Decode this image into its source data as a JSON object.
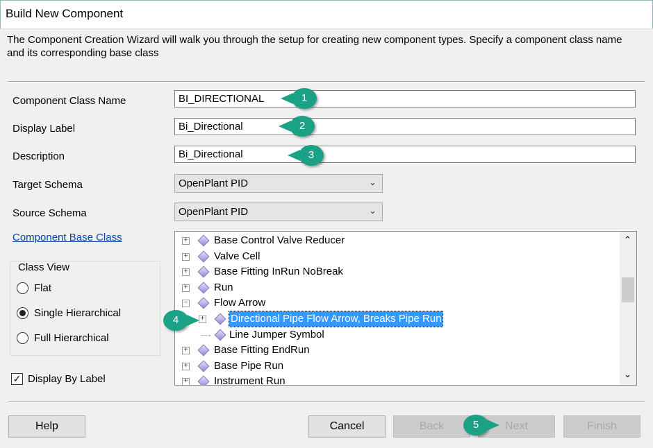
{
  "title": "Build New Component",
  "description": "The Component Creation Wizard will walk you through the setup for creating new component types.  Specify a component class name and its corresponding base class",
  "fields": {
    "class_name": {
      "label": "Component Class Name",
      "value": "BI_DIRECTIONAL"
    },
    "display_label": {
      "label": "Display Label",
      "value": "Bi_Directional"
    },
    "description": {
      "label": "Description",
      "value": "Bi_Directional"
    },
    "target_schema": {
      "label": "Target Schema",
      "value": "OpenPlant PID"
    },
    "source_schema": {
      "label": "Source Schema",
      "value": "OpenPlant PID"
    }
  },
  "base_class_link": "Component Base Class",
  "tree": [
    {
      "label": "Base Control Valve Reducer",
      "level": 0,
      "expander": "+"
    },
    {
      "label": "Valve Cell",
      "level": 0,
      "expander": "+"
    },
    {
      "label": "Base Fitting InRun NoBreak",
      "level": 0,
      "expander": "+"
    },
    {
      "label": "Run",
      "level": 0,
      "expander": "+"
    },
    {
      "label": "Flow Arrow",
      "level": 0,
      "expander": "-"
    },
    {
      "label": "Directional Pipe Flow Arrow, Breaks Pipe Run",
      "level": 1,
      "expander": "+",
      "selected": true
    },
    {
      "label": "Line Jumper Symbol",
      "level": 1,
      "expander": ""
    },
    {
      "label": "Base Fitting EndRun",
      "level": 0,
      "expander": "+"
    },
    {
      "label": "Base Pipe Run",
      "level": 0,
      "expander": "+"
    },
    {
      "label": "Instrument Run",
      "level": 0,
      "expander": "+"
    }
  ],
  "class_view": {
    "title": "Class View",
    "options": [
      "Flat",
      "Single Hierarchical",
      "Full Hierarchical"
    ],
    "selected": 1
  },
  "display_by_label": {
    "label": "Display By Label",
    "checked": true
  },
  "buttons": {
    "help": "Help",
    "cancel": "Cancel",
    "back": "Back",
    "next": "Next",
    "finish": "Finish"
  },
  "callouts": [
    "1",
    "2",
    "3",
    "4",
    "5"
  ],
  "colors": {
    "callout": "#1ba185",
    "selection": "#3399ff"
  }
}
